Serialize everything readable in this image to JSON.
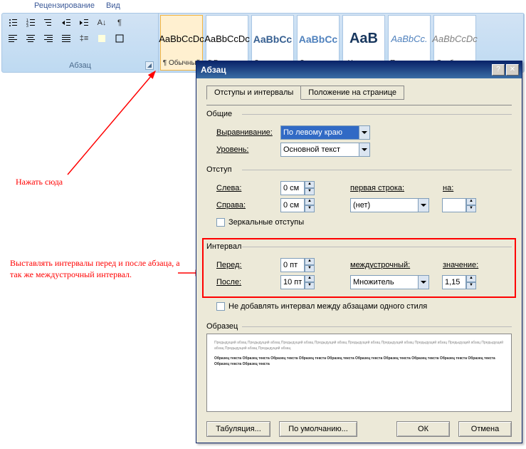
{
  "ribbon": {
    "tabs": [
      "Рецензирование",
      "Вид"
    ],
    "paragraph_group": "Абзац",
    "styles": [
      {
        "sample": "AaBbCcDc",
        "name": "¶ Обычный",
        "color": "#000",
        "size": "13px",
        "italic": false,
        "selected": true
      },
      {
        "sample": "AaBbCcDc",
        "name": "¶ Без инте...",
        "color": "#000",
        "size": "13px",
        "italic": false,
        "selected": false
      },
      {
        "sample": "AaBbCc",
        "name": "Заголово...",
        "color": "#365f91",
        "size": "14px",
        "italic": false,
        "selected": false,
        "bold": true
      },
      {
        "sample": "AaBbCc",
        "name": "Заголово...",
        "color": "#4f81bd",
        "size": "14px",
        "italic": false,
        "selected": false,
        "bold": true
      },
      {
        "sample": "AaB",
        "name": "Название",
        "color": "#17365d",
        "size": "20px",
        "italic": false,
        "selected": false,
        "bold": true
      },
      {
        "sample": "AaBbCc.",
        "name": "Подзаголо...",
        "color": "#4f81bd",
        "size": "13px",
        "italic": true,
        "selected": false
      },
      {
        "sample": "AaBbCcDc",
        "name": "Слабое в...",
        "color": "#808080",
        "size": "13px",
        "italic": true,
        "selected": false
      }
    ]
  },
  "annotations": {
    "a1": "Нажать сюда",
    "a2": "Выставлять интервалы перед и после абзаца, а так же междустрочный интервал."
  },
  "dialog": {
    "title": "Абзац",
    "tabs": {
      "t1": "Отступы и интервалы",
      "t2": "Положение на странице"
    },
    "general": {
      "title": "Общие",
      "align_label": "Выравнивание:",
      "align_value": "По левому краю",
      "level_label": "Уровень:",
      "level_value": "Основной текст"
    },
    "indent": {
      "title": "Отступ",
      "left_label": "Слева:",
      "left_value": "0 см",
      "right_label": "Справа:",
      "right_value": "0 см",
      "firstline_label": "первая строка:",
      "firstline_value": "(нет)",
      "by_label": "на:",
      "by_value": "",
      "mirror": "Зеркальные отступы"
    },
    "interval": {
      "title": "Интервал",
      "before_label": "Перед:",
      "before_value": "0 пт",
      "after_label": "После:",
      "after_value": "10 пт",
      "line_label": "междустрочный:",
      "line_value": "Множитель",
      "at_label": "значение:",
      "at_value": "1,15",
      "noadd": "Не добавлять интервал между абзацами одного стиля"
    },
    "preview": {
      "title": "Образец",
      "prev_text": "Предыдущий абзац Предыдущий абзац Предыдущий абзац Предыдущий абзац Предыдущий абзац Предыдущий абзац Предыдущий абзац Предыдущий абзац Предыдущий абзац Предыдущий абзац Предыдущий абзац",
      "curr_text": "Образец текста Образец текста Образец текста Образец текста Образец текста Образец текста Образец текста Образец текста Образец текста Образец текста Образец текста Образец текста"
    },
    "buttons": {
      "tabs": "Табуляция...",
      "default": "По умолчанию...",
      "ok": "ОК",
      "cancel": "Отмена"
    }
  }
}
